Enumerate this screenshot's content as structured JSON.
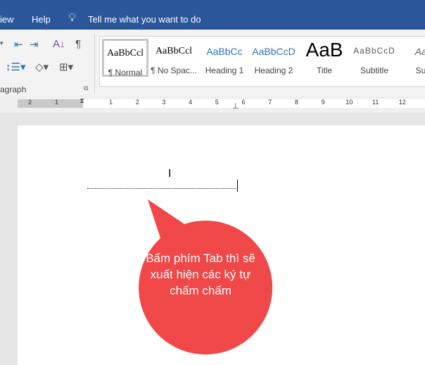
{
  "titlebar": {
    "menu_view": "iew",
    "menu_help": "Help",
    "tell_me": "Tell me what you want to do"
  },
  "ribbon": {
    "group_label": "agraph",
    "styles": [
      {
        "preview": "AaBbCcl",
        "label": "¶ Normal",
        "color": "#000000"
      },
      {
        "preview": "AaBbCcl",
        "label": "¶ No Spac...",
        "color": "#000000"
      },
      {
        "preview": "AaBbCc",
        "label": "Heading 1",
        "color": "#2e74b5"
      },
      {
        "preview": "AaBbCcD",
        "label": "Heading 2",
        "color": "#2e74b5"
      },
      {
        "preview": "AaB",
        "label": "Title",
        "color": "#000000"
      },
      {
        "preview": "AaBbCcD",
        "label": "Subtitle",
        "color": "#5a5a5a"
      },
      {
        "preview": "AaB",
        "label": "Subt",
        "color": "#5a5a5a"
      }
    ]
  },
  "ruler": {
    "left": [
      "2",
      "1"
    ],
    "right": [
      "1",
      "2",
      "3",
      "4",
      "5",
      "6",
      "7",
      "8",
      "9",
      "10",
      "11",
      "12"
    ]
  },
  "callout": {
    "text": "Bấm phím Tab thì sẽ xuất hiện các ký tự chấm chấm",
    "color": "#f04848"
  }
}
